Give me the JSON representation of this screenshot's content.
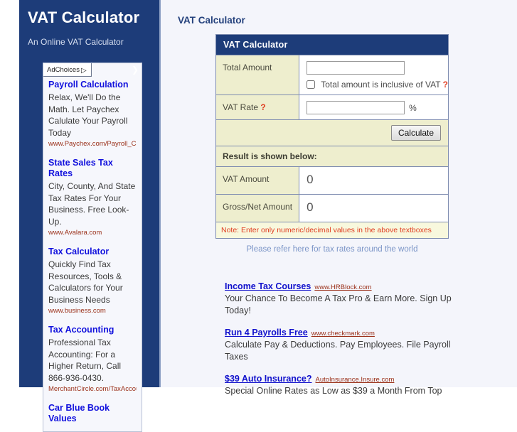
{
  "sidebar": {
    "title": "VAT Calculator",
    "tagline": "An Online VAT Calculator",
    "ad_unit": {
      "adchoices_label": "AdChoices",
      "adchoices_triangle": "▷",
      "arrow": "❯",
      "items": [
        {
          "title": "Payroll Calculation",
          "desc": "Relax, We'll Do the Math. Let Paychex Calulate Your Payroll Today",
          "url": "www.Paychex.com/Payroll_Ca…"
        },
        {
          "title": "State Sales Tax Rates",
          "desc": "City, County, And State Tax Rates For Your Business. Free Look-Up.",
          "url": "www.Avalara.com"
        },
        {
          "title": "Tax Calculator",
          "desc": "Quickly Find Tax Resources, Tools & Calculators for Your Business Needs",
          "url": "www.business.com"
        },
        {
          "title": "Tax Accounting",
          "desc": "Professional Tax Accounting: For a Higher Return, Call 866-936-0430.",
          "url": "MerchantCircle.com/TaxAccou…"
        },
        {
          "title": "Car Blue Book Values",
          "desc": "",
          "url": ""
        }
      ]
    }
  },
  "main": {
    "page_heading": "VAT Calculator",
    "calculator": {
      "panel_title": "VAT Calculator",
      "total_amount_label": "Total Amount",
      "total_amount_value": "",
      "total_amount_placeholder": "",
      "inclusive_label": "Total amount is inclusive of VAT",
      "inclusive_checked": false,
      "inclusive_help": "?",
      "vat_rate_label": "VAT Rate",
      "vat_rate_help": "?",
      "vat_rate_value": "",
      "vat_rate_placeholder": "",
      "percent_symbol": "%",
      "calculate_label": "Calculate",
      "result_header": "Result is shown below:",
      "vat_amount_label": "VAT Amount",
      "vat_amount_value": "0",
      "gross_net_label": "Gross/Net Amount",
      "gross_net_value": "0",
      "note": "Note: Enter only numeric/decimal values in the above textboxes",
      "refer_link": "Please refer here for tax rates around the world"
    },
    "bottom_ads": [
      {
        "title": "Income Tax Courses",
        "url": "www.HRBlock.com",
        "desc": "Your Chance To Become A Tax Pro & Earn More. Sign Up Today!"
      },
      {
        "title": "Run 4 Payrolls Free",
        "url": "www.checkmark.com",
        "desc": "Calculate Pay & Deductions. Pay Employees. File Payroll Taxes"
      },
      {
        "title": "$39 Auto Insurance?",
        "url": "AutoInsurance.Insure.com",
        "desc": "Special Online Rates as Low as $39 a Month From Top"
      }
    ]
  },
  "colors": {
    "brand_navy": "#1d3c79",
    "page_bg": "#f4f5fb",
    "label_cream": "#eeeece",
    "note_red": "#e03c20",
    "ad_title_blue": "#1111cc",
    "ad_url_red": "#9a2f18"
  }
}
